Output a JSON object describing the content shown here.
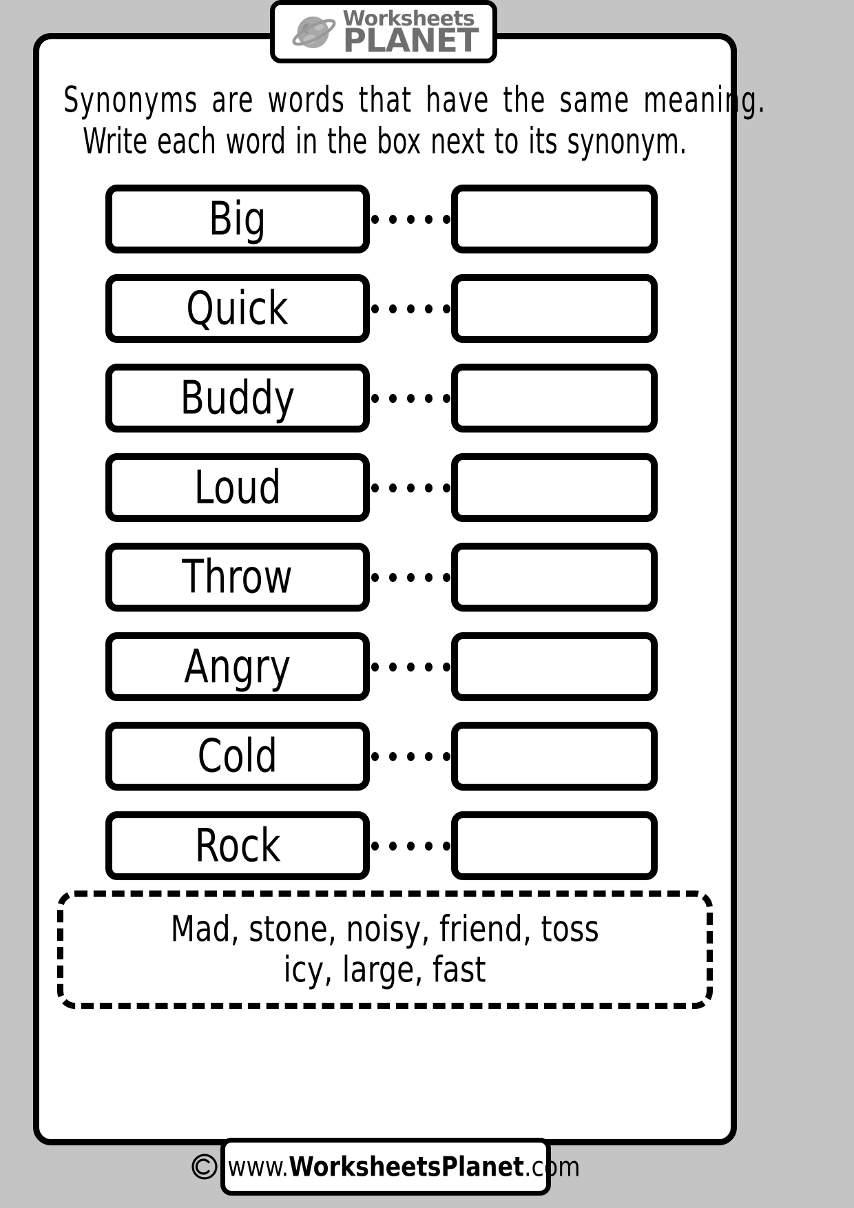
{
  "page": {
    "background_color": "#c4c4c4",
    "sheet_color": "#ffffff",
    "border_color": "#000000"
  },
  "logo": {
    "icon": "planet-icon",
    "word_top": "Worksheets",
    "word_bottom": "PLANET",
    "color": "#6e6e6e"
  },
  "instructions": {
    "line1": "Synonyms are words that have the same meaning.",
    "line2": "Write each word in the box next to its synonym."
  },
  "exercise": {
    "dots_per_connector": 5,
    "rows": [
      {
        "word": "Big",
        "answer": ""
      },
      {
        "word": "Quick",
        "answer": ""
      },
      {
        "word": "Buddy",
        "answer": ""
      },
      {
        "word": "Loud",
        "answer": ""
      },
      {
        "word": "Throw",
        "answer": ""
      },
      {
        "word": "Angry",
        "answer": ""
      },
      {
        "word": "Cold",
        "answer": ""
      },
      {
        "word": "Rock",
        "answer": ""
      }
    ]
  },
  "word_bank": {
    "line1": "Mad, stone, noisy, friend, toss",
    "line2": "icy, large, fast",
    "words": [
      "Mad",
      "stone",
      "noisy",
      "friend",
      "toss",
      "icy",
      "large",
      "fast"
    ]
  },
  "footer": {
    "icon": "copyright-icon",
    "url_prefix": "www.",
    "url_brand": "WorksheetsPlanet",
    "url_suffix": ".com",
    "url_full": "www.WorksheetsPlanet.com"
  }
}
